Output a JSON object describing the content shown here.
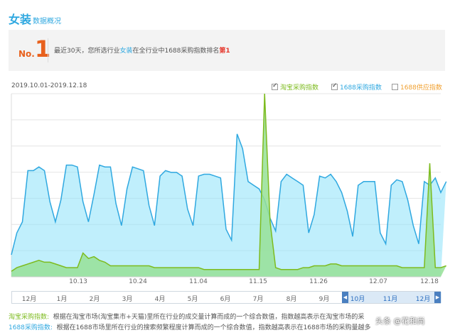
{
  "header": {
    "title_big": "女装",
    "title_small": "数据概况"
  },
  "rank": {
    "no_prefix": "No.",
    "no_number": "1",
    "text_a": "最近30天，您所选行业",
    "text_hl": "女装",
    "text_b": "在全行业中1688采购指数排名",
    "text_rank": "第1"
  },
  "daterange": "2019.10.01-2019.12.18",
  "legend": [
    {
      "label": "淘宝采购指数",
      "checked": true,
      "color": "#7dbb1e"
    },
    {
      "label": "1688采购指数",
      "checked": true,
      "color": "#2fa8e0"
    },
    {
      "label": "1688供应指数",
      "checked": false,
      "color": "#f0a030"
    }
  ],
  "x_ticks": [
    "10.13",
    "10.24",
    "11.04",
    "11.15",
    "11.26",
    "12.07",
    "12.18"
  ],
  "nav_months": [
    "12月",
    "1月",
    "2月",
    "3月",
    "4月",
    "5月",
    "6月",
    "7月",
    "8月",
    "9月",
    "10月",
    "11月",
    "12月"
  ],
  "notes": {
    "taobao_label": "淘宝采购指数:",
    "taobao_text": "根据在淘宝市场(淘宝集市+天猫)里所在行业的成交量计算而成的一个综合数值，指数越高表示在淘宝市场的采",
    "ali_label": "1688采购指数:",
    "ali_text": "根据在1688市场里所在行业的搜索频繁程度计算而成的一个综合数值，指数越高表示在1688市场的采购量越多"
  },
  "watermark": "头条 @花和尚",
  "chart_data": {
    "type": "area",
    "x": [
      "10.01",
      "10.02",
      "10.03",
      "10.04",
      "10.05",
      "10.06",
      "10.07",
      "10.08",
      "10.09",
      "10.10",
      "10.11",
      "10.12",
      "10.13",
      "10.14",
      "10.15",
      "10.16",
      "10.17",
      "10.18",
      "10.19",
      "10.20",
      "10.21",
      "10.22",
      "10.23",
      "10.24",
      "10.25",
      "10.26",
      "10.27",
      "10.28",
      "10.29",
      "10.30",
      "10.31",
      "11.01",
      "11.02",
      "11.03",
      "11.04",
      "11.05",
      "11.06",
      "11.07",
      "11.08",
      "11.09",
      "11.10",
      "11.11",
      "11.12",
      "11.13",
      "11.14",
      "11.15",
      "11.16",
      "11.17",
      "11.18",
      "11.19",
      "11.20",
      "11.21",
      "11.22",
      "11.23",
      "11.24",
      "11.25",
      "11.26",
      "11.27",
      "11.28",
      "11.29",
      "11.30",
      "12.01",
      "12.02",
      "12.03",
      "12.04",
      "12.05",
      "12.06",
      "12.07",
      "12.08",
      "12.09",
      "12.10",
      "12.11",
      "12.12",
      "12.13",
      "12.14",
      "12.15",
      "12.16",
      "12.17",
      "12.18"
    ],
    "series": [
      {
        "name": "淘宝采购指数",
        "color": "#7dbb1e",
        "values": [
          3,
          5,
          6,
          7,
          8,
          9,
          8,
          8,
          7,
          6,
          5,
          5,
          5,
          13,
          10,
          11,
          9,
          8,
          6,
          6,
          6,
          6,
          6,
          6,
          6,
          6,
          5,
          5,
          5,
          5,
          5,
          5,
          5,
          5,
          5,
          4,
          4,
          4,
          4,
          4,
          4,
          4,
          4,
          4,
          4,
          4,
          100,
          30,
          5,
          4,
          4,
          4,
          4,
          5,
          5,
          6,
          6,
          6,
          7,
          7,
          6,
          6,
          6,
          6,
          6,
          6,
          6,
          6,
          6,
          6,
          6,
          5,
          5,
          5,
          5,
          5,
          62,
          5,
          5,
          6
        ]
      },
      {
        "name": "1688采购指数",
        "color": "#2fa8e0",
        "values": [
          12,
          24,
          30,
          58,
          58,
          60,
          58,
          41,
          30,
          42,
          61,
          61,
          60,
          41,
          30,
          45,
          61,
          60,
          60,
          40,
          28,
          48,
          60,
          59,
          58,
          39,
          28,
          55,
          58,
          57,
          57,
          55,
          37,
          28,
          55,
          56,
          56,
          55,
          54,
          26,
          20,
          78,
          70,
          52,
          50,
          48,
          42,
          32,
          25,
          52,
          56,
          54,
          52,
          50,
          24,
          34,
          55,
          54,
          56,
          52,
          46,
          36,
          22,
          50,
          52,
          52,
          52,
          24,
          18,
          50,
          53,
          52,
          42,
          28,
          18,
          52,
          50,
          54,
          46,
          52
        ]
      }
    ],
    "ylim": [
      0,
      100
    ]
  }
}
